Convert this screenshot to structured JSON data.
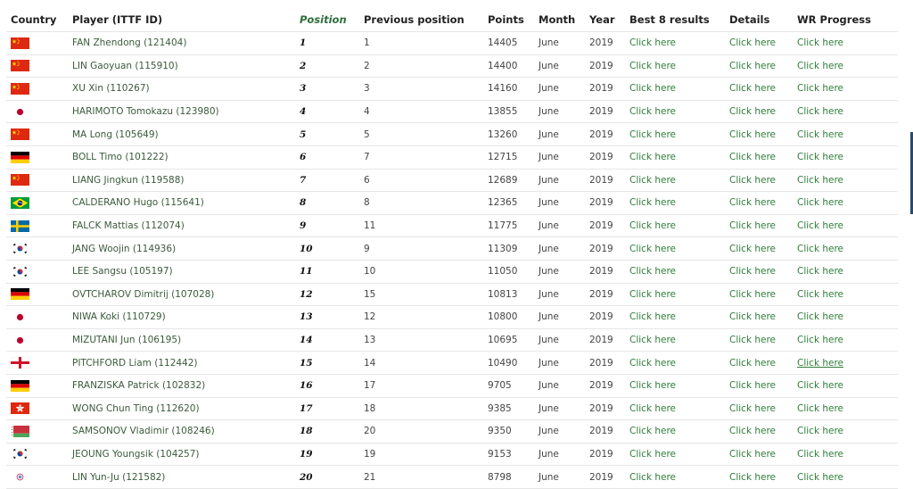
{
  "headers": {
    "country": "Country",
    "player": "Player (ITTF ID)",
    "position": "Position",
    "previous": "Previous position",
    "points": "Points",
    "month": "Month",
    "year": "Year",
    "best8": "Best 8 results",
    "details": "Details",
    "progress": "WR Progress"
  },
  "rows": [
    {
      "flag": "flag-china-icon",
      "player": "FAN Zhendong (121404)",
      "position": "1",
      "previous": "1",
      "points": "14405",
      "month": "June",
      "year": "2019",
      "best8": "Click here",
      "details": "Click here",
      "progress": "Click here"
    },
    {
      "flag": "flag-china-icon",
      "player": "LIN Gaoyuan (115910)",
      "position": "2",
      "previous": "2",
      "points": "14400",
      "month": "June",
      "year": "2019",
      "best8": "Click here",
      "details": "Click here",
      "progress": "Click here"
    },
    {
      "flag": "flag-china-icon",
      "player": "XU Xin (110267)",
      "position": "3",
      "previous": "3",
      "points": "14160",
      "month": "June",
      "year": "2019",
      "best8": "Click here",
      "details": "Click here",
      "progress": "Click here"
    },
    {
      "flag": "flag-japan-icon",
      "player": "HARIMOTO Tomokazu (123980)",
      "position": "4",
      "previous": "4",
      "points": "13855",
      "month": "June",
      "year": "2019",
      "best8": "Click here",
      "details": "Click here",
      "progress": "Click here"
    },
    {
      "flag": "flag-china-icon",
      "player": "MA Long (105649)",
      "position": "5",
      "previous": "5",
      "points": "13260",
      "month": "June",
      "year": "2019",
      "best8": "Click here",
      "details": "Click here",
      "progress": "Click here"
    },
    {
      "flag": "flag-germany-icon",
      "player": "BOLL Timo (101222)",
      "position": "6",
      "previous": "7",
      "points": "12715",
      "month": "June",
      "year": "2019",
      "best8": "Click here",
      "details": "Click here",
      "progress": "Click here"
    },
    {
      "flag": "flag-china-icon",
      "player": "LIANG Jingkun (119588)",
      "position": "7",
      "previous": "6",
      "points": "12689",
      "month": "June",
      "year": "2019",
      "best8": "Click here",
      "details": "Click here",
      "progress": "Click here"
    },
    {
      "flag": "flag-brazil-icon",
      "player": "CALDERANO Hugo (115641)",
      "position": "8",
      "previous": "8",
      "points": "12365",
      "month": "June",
      "year": "2019",
      "best8": "Click here",
      "details": "Click here",
      "progress": "Click here"
    },
    {
      "flag": "flag-sweden-icon",
      "player": "FALCK Mattias (112074)",
      "position": "9",
      "previous": "11",
      "points": "11775",
      "month": "June",
      "year": "2019",
      "best8": "Click here",
      "details": "Click here",
      "progress": "Click here"
    },
    {
      "flag": "flag-korea-icon",
      "player": "JANG Woojin (114936)",
      "position": "10",
      "previous": "9",
      "points": "11309",
      "month": "June",
      "year": "2019",
      "best8": "Click here",
      "details": "Click here",
      "progress": "Click here"
    },
    {
      "flag": "flag-korea-icon",
      "player": "LEE Sangsu (105197)",
      "position": "11",
      "previous": "10",
      "points": "11050",
      "month": "June",
      "year": "2019",
      "best8": "Click here",
      "details": "Click here",
      "progress": "Click here"
    },
    {
      "flag": "flag-germany-icon",
      "player": "OVTCHAROV Dimitrij (107028)",
      "position": "12",
      "previous": "15",
      "points": "10813",
      "month": "June",
      "year": "2019",
      "best8": "Click here",
      "details": "Click here",
      "progress": "Click here"
    },
    {
      "flag": "flag-japan-icon",
      "player": "NIWA Koki (110729)",
      "position": "13",
      "previous": "12",
      "points": "10800",
      "month": "June",
      "year": "2019",
      "best8": "Click here",
      "details": "Click here",
      "progress": "Click here"
    },
    {
      "flag": "flag-japan-icon",
      "player": "MIZUTANI Jun (106195)",
      "position": "14",
      "previous": "13",
      "points": "10695",
      "month": "June",
      "year": "2019",
      "best8": "Click here",
      "details": "Click here",
      "progress": "Click here"
    },
    {
      "flag": "flag-england-icon",
      "player": "PITCHFORD Liam (112442)",
      "position": "15",
      "previous": "14",
      "points": "10490",
      "month": "June",
      "year": "2019",
      "best8": "Click here",
      "details": "Click here",
      "progress": "Click here"
    },
    {
      "flag": "flag-germany-icon",
      "player": "FRANZISKA Patrick (102832)",
      "position": "16",
      "previous": "17",
      "points": "9705",
      "month": "June",
      "year": "2019",
      "best8": "Click here",
      "details": "Click here",
      "progress": "Click here"
    },
    {
      "flag": "flag-hongkong-icon",
      "player": "WONG Chun Ting (112620)",
      "position": "17",
      "previous": "18",
      "points": "9385",
      "month": "June",
      "year": "2019",
      "best8": "Click here",
      "details": "Click here",
      "progress": "Click here"
    },
    {
      "flag": "flag-belarus-icon",
      "player": "SAMSONOV Vladimir (108246)",
      "position": "18",
      "previous": "20",
      "points": "9350",
      "month": "June",
      "year": "2019",
      "best8": "Click here",
      "details": "Click here",
      "progress": "Click here"
    },
    {
      "flag": "flag-korea-icon",
      "player": "JEOUNG Youngsik (104257)",
      "position": "19",
      "previous": "19",
      "points": "9153",
      "month": "June",
      "year": "2019",
      "best8": "Click here",
      "details": "Click here",
      "progress": "Click here"
    },
    {
      "flag": "flag-chinese-taipei-icon",
      "player": "LIN Yun-Ju (121582)",
      "position": "20",
      "previous": "21",
      "points": "8798",
      "month": "June",
      "year": "2019",
      "best8": "Click here",
      "details": "Click here",
      "progress": "Click here"
    }
  ],
  "hovered_link": {
    "row": 15,
    "column": "progress"
  },
  "colors": {
    "link": "#2f7d3a",
    "position_header": "#2d6e3a",
    "row_border": "#e6e6e6"
  }
}
